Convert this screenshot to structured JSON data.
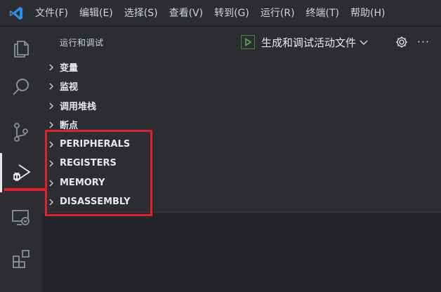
{
  "menu": {
    "items": [
      "文件(F)",
      "编辑(E)",
      "选择(S)",
      "查看(V)",
      "转到(G)",
      "运行(R)",
      "终端(T)",
      "帮助(H)"
    ]
  },
  "activity_bar": {
    "icons": [
      "explorer-icon",
      "search-icon",
      "source-control-icon",
      "run-debug-icon",
      "remote-explorer-icon",
      "extensions-icon"
    ],
    "active": "run-debug-icon"
  },
  "sidebar": {
    "title": "运行和调试",
    "run_config_label": "生成和调试活动文件",
    "more_label": "···",
    "sections": [
      "变量",
      "监视",
      "调用堆栈",
      "断点",
      "PERIPHERALS",
      "REGISTERS",
      "MEMORY",
      "DISASSEMBLY"
    ]
  },
  "colors": {
    "accent_red": "#e0202a",
    "run_green": "#3f8a3a",
    "logo_blue": "#2f8fe6"
  }
}
